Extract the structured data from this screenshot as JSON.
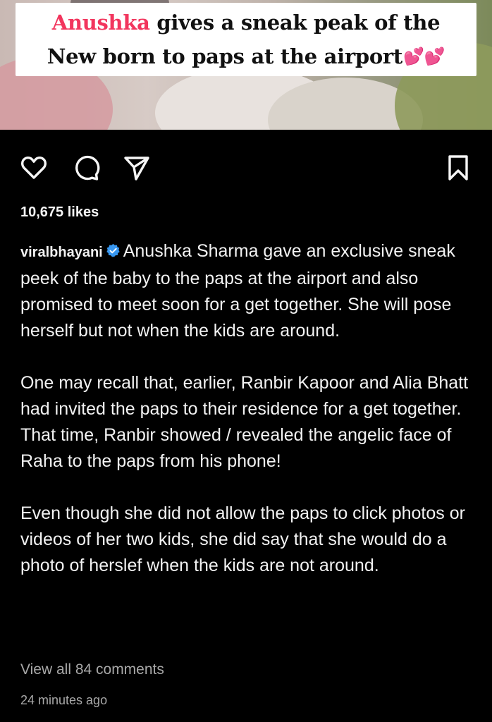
{
  "post": {
    "image": {
      "headline_name": "Anushka",
      "headline_rest_line1": " gives a sneak peak of the",
      "headline_line2": "New born to paps at the airport",
      "headline_emoji": "💕💕"
    },
    "actions": {
      "like_icon": "heart-outline-icon",
      "comment_icon": "comment-bubble-icon",
      "share_icon": "send-paper-plane-icon",
      "save_icon": "bookmark-outline-icon"
    },
    "likes": "10,675 likes",
    "caption": {
      "username": "viralbhayani",
      "paragraph_1": "Anushka Sharma gave an exclusive sneak peek of the baby to the paps at the airport and also promised to meet soon for a get together. She will pose herself but not when the kids are around.",
      "paragraph_2": "One may recall that, earlier, Ranbir Kapoor and Alia Bhatt had invited the paps to their residence for a get together. That time, Ranbir showed / revealed the angelic face of Raha to the paps from his phone!",
      "paragraph_3": "Even though she did not allow the paps to click photos or videos of her two kids, she did say that she would do a photo of herslef when the kids are not around."
    },
    "view_comments": "View all 84 comments",
    "timestamp": "24 minutes ago"
  },
  "colors": {
    "background": "#000000",
    "headline_accent": "#f2355d",
    "verified_badge": "#3797f0",
    "secondary_text": "#a8a8a8"
  }
}
